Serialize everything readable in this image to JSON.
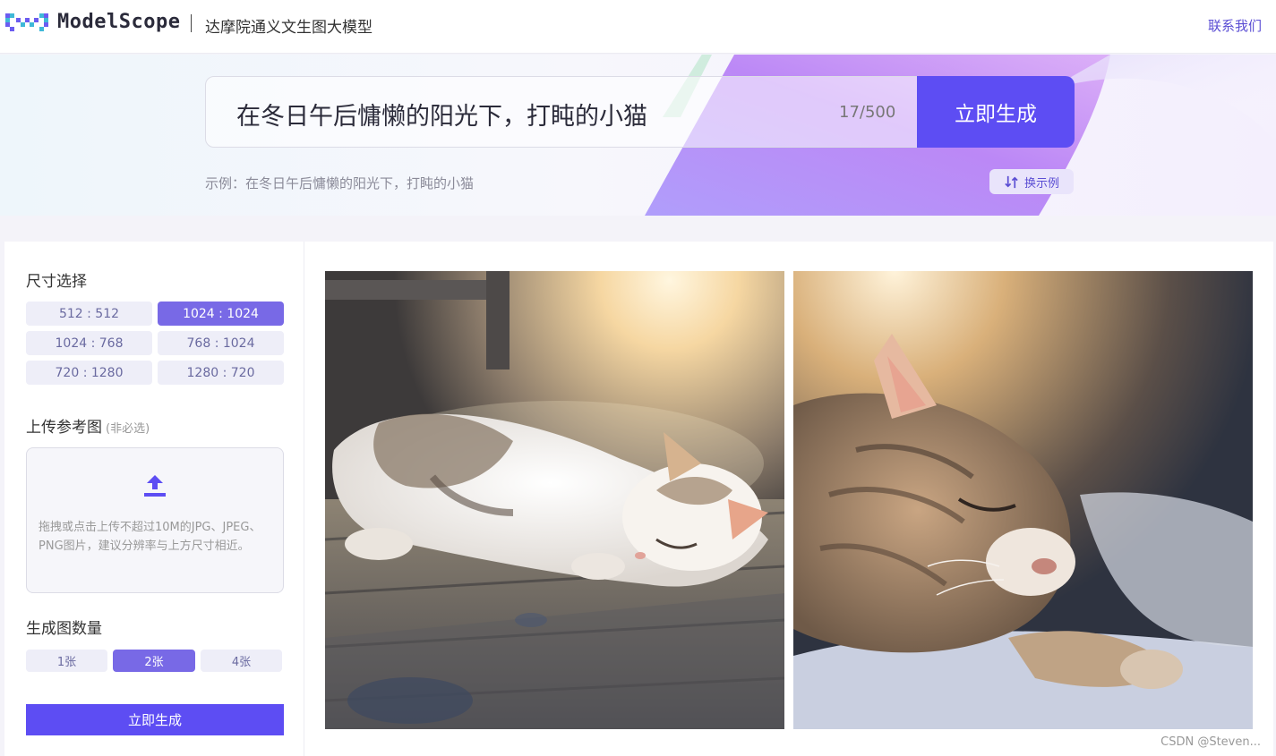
{
  "header": {
    "logo_word": "ModelScope",
    "app_title": "达摩院通义文生图大模型",
    "contact_label": "联系我们"
  },
  "prompt": {
    "value": "在冬日午后慵懒的阳光下，打盹的小猫",
    "char_count": "17/500",
    "generate_label": "立即生成",
    "example_text": "示例：在冬日午后慵懒的阳光下，打盹的小猫",
    "swap_label": "换示例"
  },
  "size_section": {
    "title": "尺寸选择",
    "options": [
      {
        "label": "512 : 512",
        "selected": false
      },
      {
        "label": "1024 : 1024",
        "selected": true
      },
      {
        "label": "1024 : 768",
        "selected": false
      },
      {
        "label": "768 : 1024",
        "selected": false
      },
      {
        "label": "720 : 1280",
        "selected": false
      },
      {
        "label": "1280 : 720",
        "selected": false
      }
    ]
  },
  "upload_section": {
    "title": "上传参考图",
    "note": "(非必选)",
    "hint": "拖拽或点击上传不超过10M的JPG、JPEG、PNG图片，建议分辨率与上方尺寸相近。"
  },
  "count_section": {
    "title": "生成图数量",
    "options": [
      {
        "label": "1张",
        "selected": false
      },
      {
        "label": "2张",
        "selected": true
      },
      {
        "label": "4张",
        "selected": false
      }
    ]
  },
  "generate_bottom_label": "立即生成",
  "watermark": "CSDN @Steven...",
  "colors": {
    "accent": "#5d4df3",
    "chip_active": "#7869e6",
    "chip_idle": "#eeeef8",
    "link": "#5b4ed4"
  },
  "icons": {
    "logo": "modelscope-logo-icon",
    "swap": "swap-icon",
    "upload": "upload-icon"
  }
}
